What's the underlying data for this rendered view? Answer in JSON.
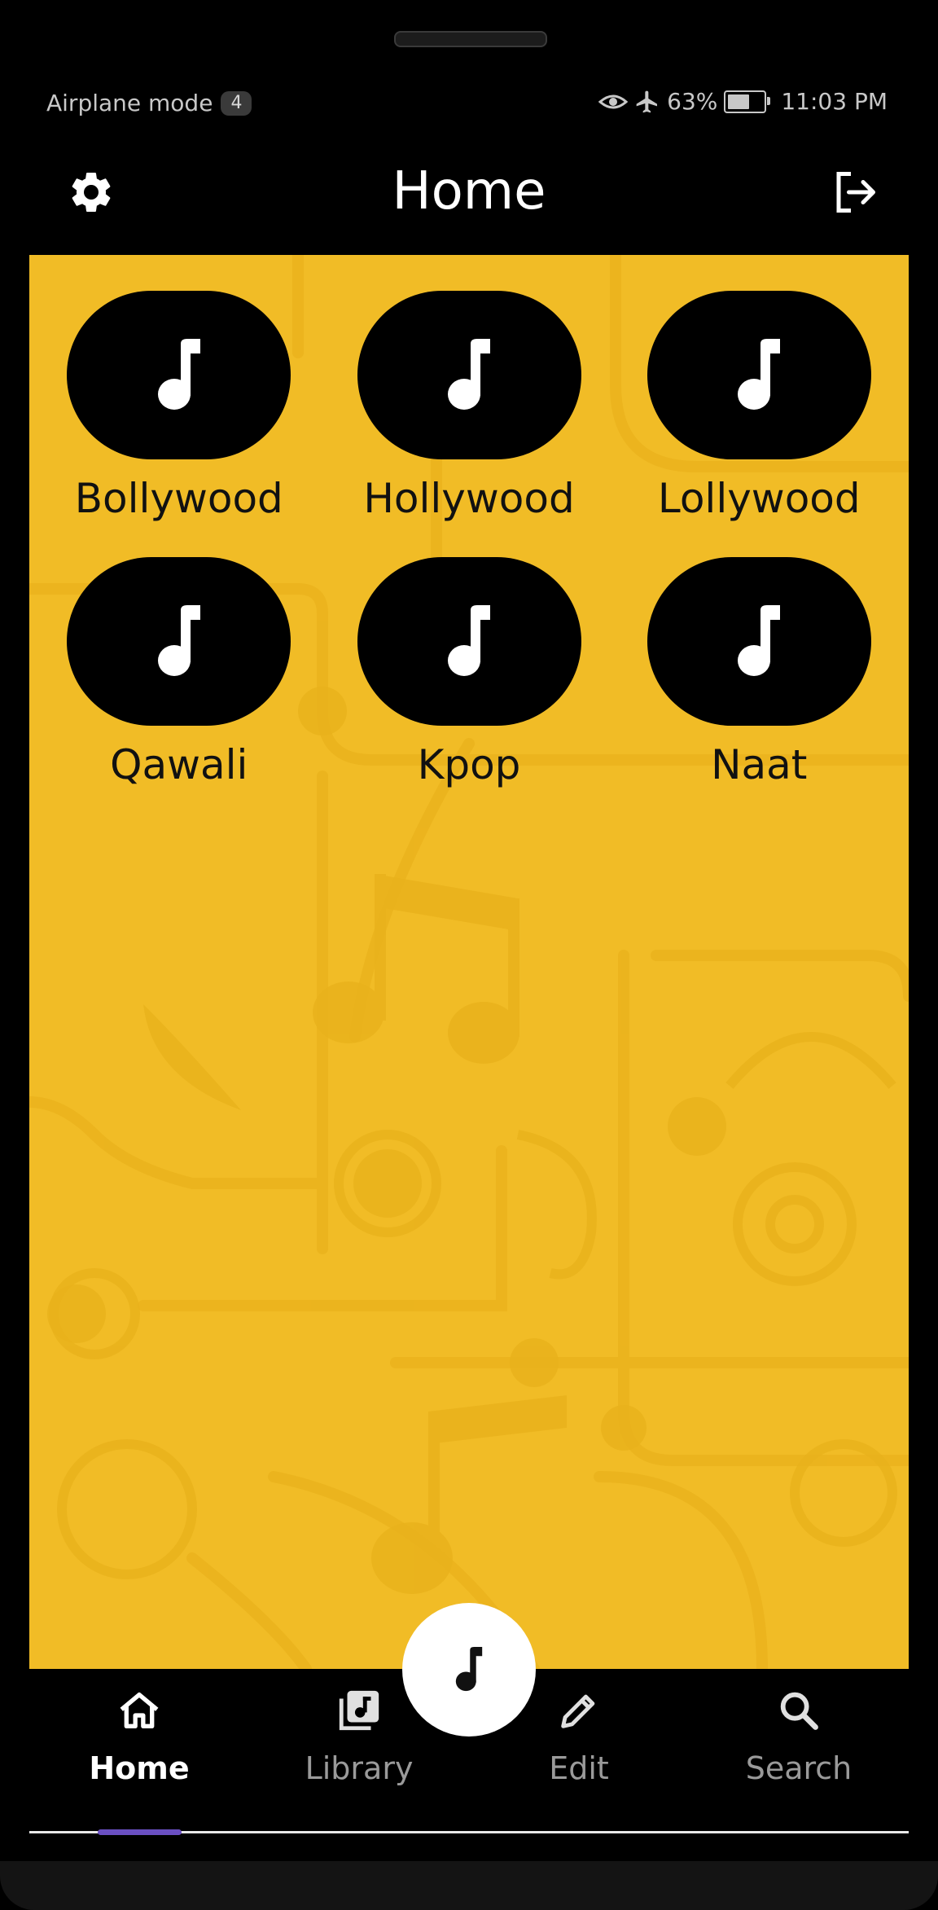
{
  "status_bar": {
    "airplane_label": "Airplane mode",
    "notification_count": "4",
    "battery_percent": "63%",
    "battery_level": 0.63,
    "time": "11:03 PM"
  },
  "app_bar": {
    "title": "Home",
    "settings_icon": "gear-icon",
    "logout_icon": "logout-icon"
  },
  "genres": [
    {
      "label": "Bollywood",
      "icon": "music-note-icon"
    },
    {
      "label": "Hollywood",
      "icon": "music-note-icon"
    },
    {
      "label": "Lollywood",
      "icon": "music-note-icon"
    },
    {
      "label": "Qawali",
      "icon": "music-note-icon"
    },
    {
      "label": "Kpop",
      "icon": "music-note-icon"
    },
    {
      "label": "Naat",
      "icon": "music-note-icon"
    }
  ],
  "fab": {
    "icon": "music-note-icon"
  },
  "bottom_nav": {
    "items": [
      {
        "label": "Home",
        "icon": "home-icon",
        "active": true
      },
      {
        "label": "Library",
        "icon": "library-music-icon",
        "active": false
      },
      {
        "label": "Edit",
        "icon": "pencil-icon",
        "active": false
      },
      {
        "label": "Search",
        "icon": "search-icon",
        "active": false
      }
    ]
  },
  "colors": {
    "background": "#000000",
    "content_bg": "#f1bc26",
    "pill": "#000000",
    "indicator": "#6a4fc2"
  }
}
